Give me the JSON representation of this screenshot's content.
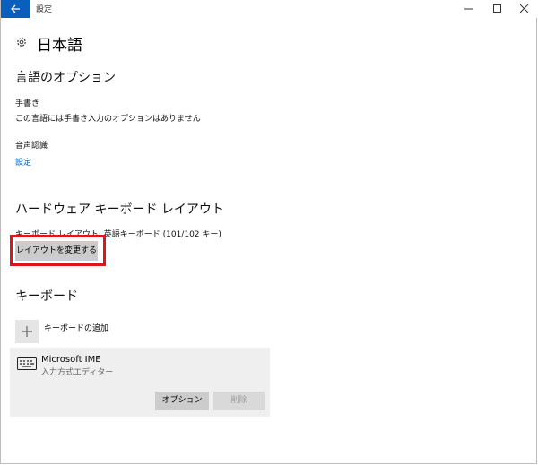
{
  "window": {
    "app_title": "設定"
  },
  "page": {
    "title": "日本語"
  },
  "language_options": {
    "heading": "言語のオプション",
    "handwriting": {
      "label": "手書き",
      "value": "この言語には手書き入力のオプションはありません"
    },
    "speech": {
      "label": "音声認識",
      "link": "設定"
    }
  },
  "hardware_keyboard": {
    "heading": "ハードウェア キーボード レイアウト",
    "layout_text": "キーボード レイアウト: 英語キーボード (101/102 キー)",
    "change_button": "レイアウトを変更する"
  },
  "keyboards": {
    "heading": "キーボード",
    "add_label": "キーボードの追加",
    "items": [
      {
        "name": "Microsoft IME",
        "subtitle": "入力方式エディター",
        "options_button": "オプション",
        "remove_button": "削除"
      }
    ]
  },
  "colors": {
    "accent": "#0a5fbd",
    "link": "#0a67c2",
    "highlight": "#e0141d"
  }
}
